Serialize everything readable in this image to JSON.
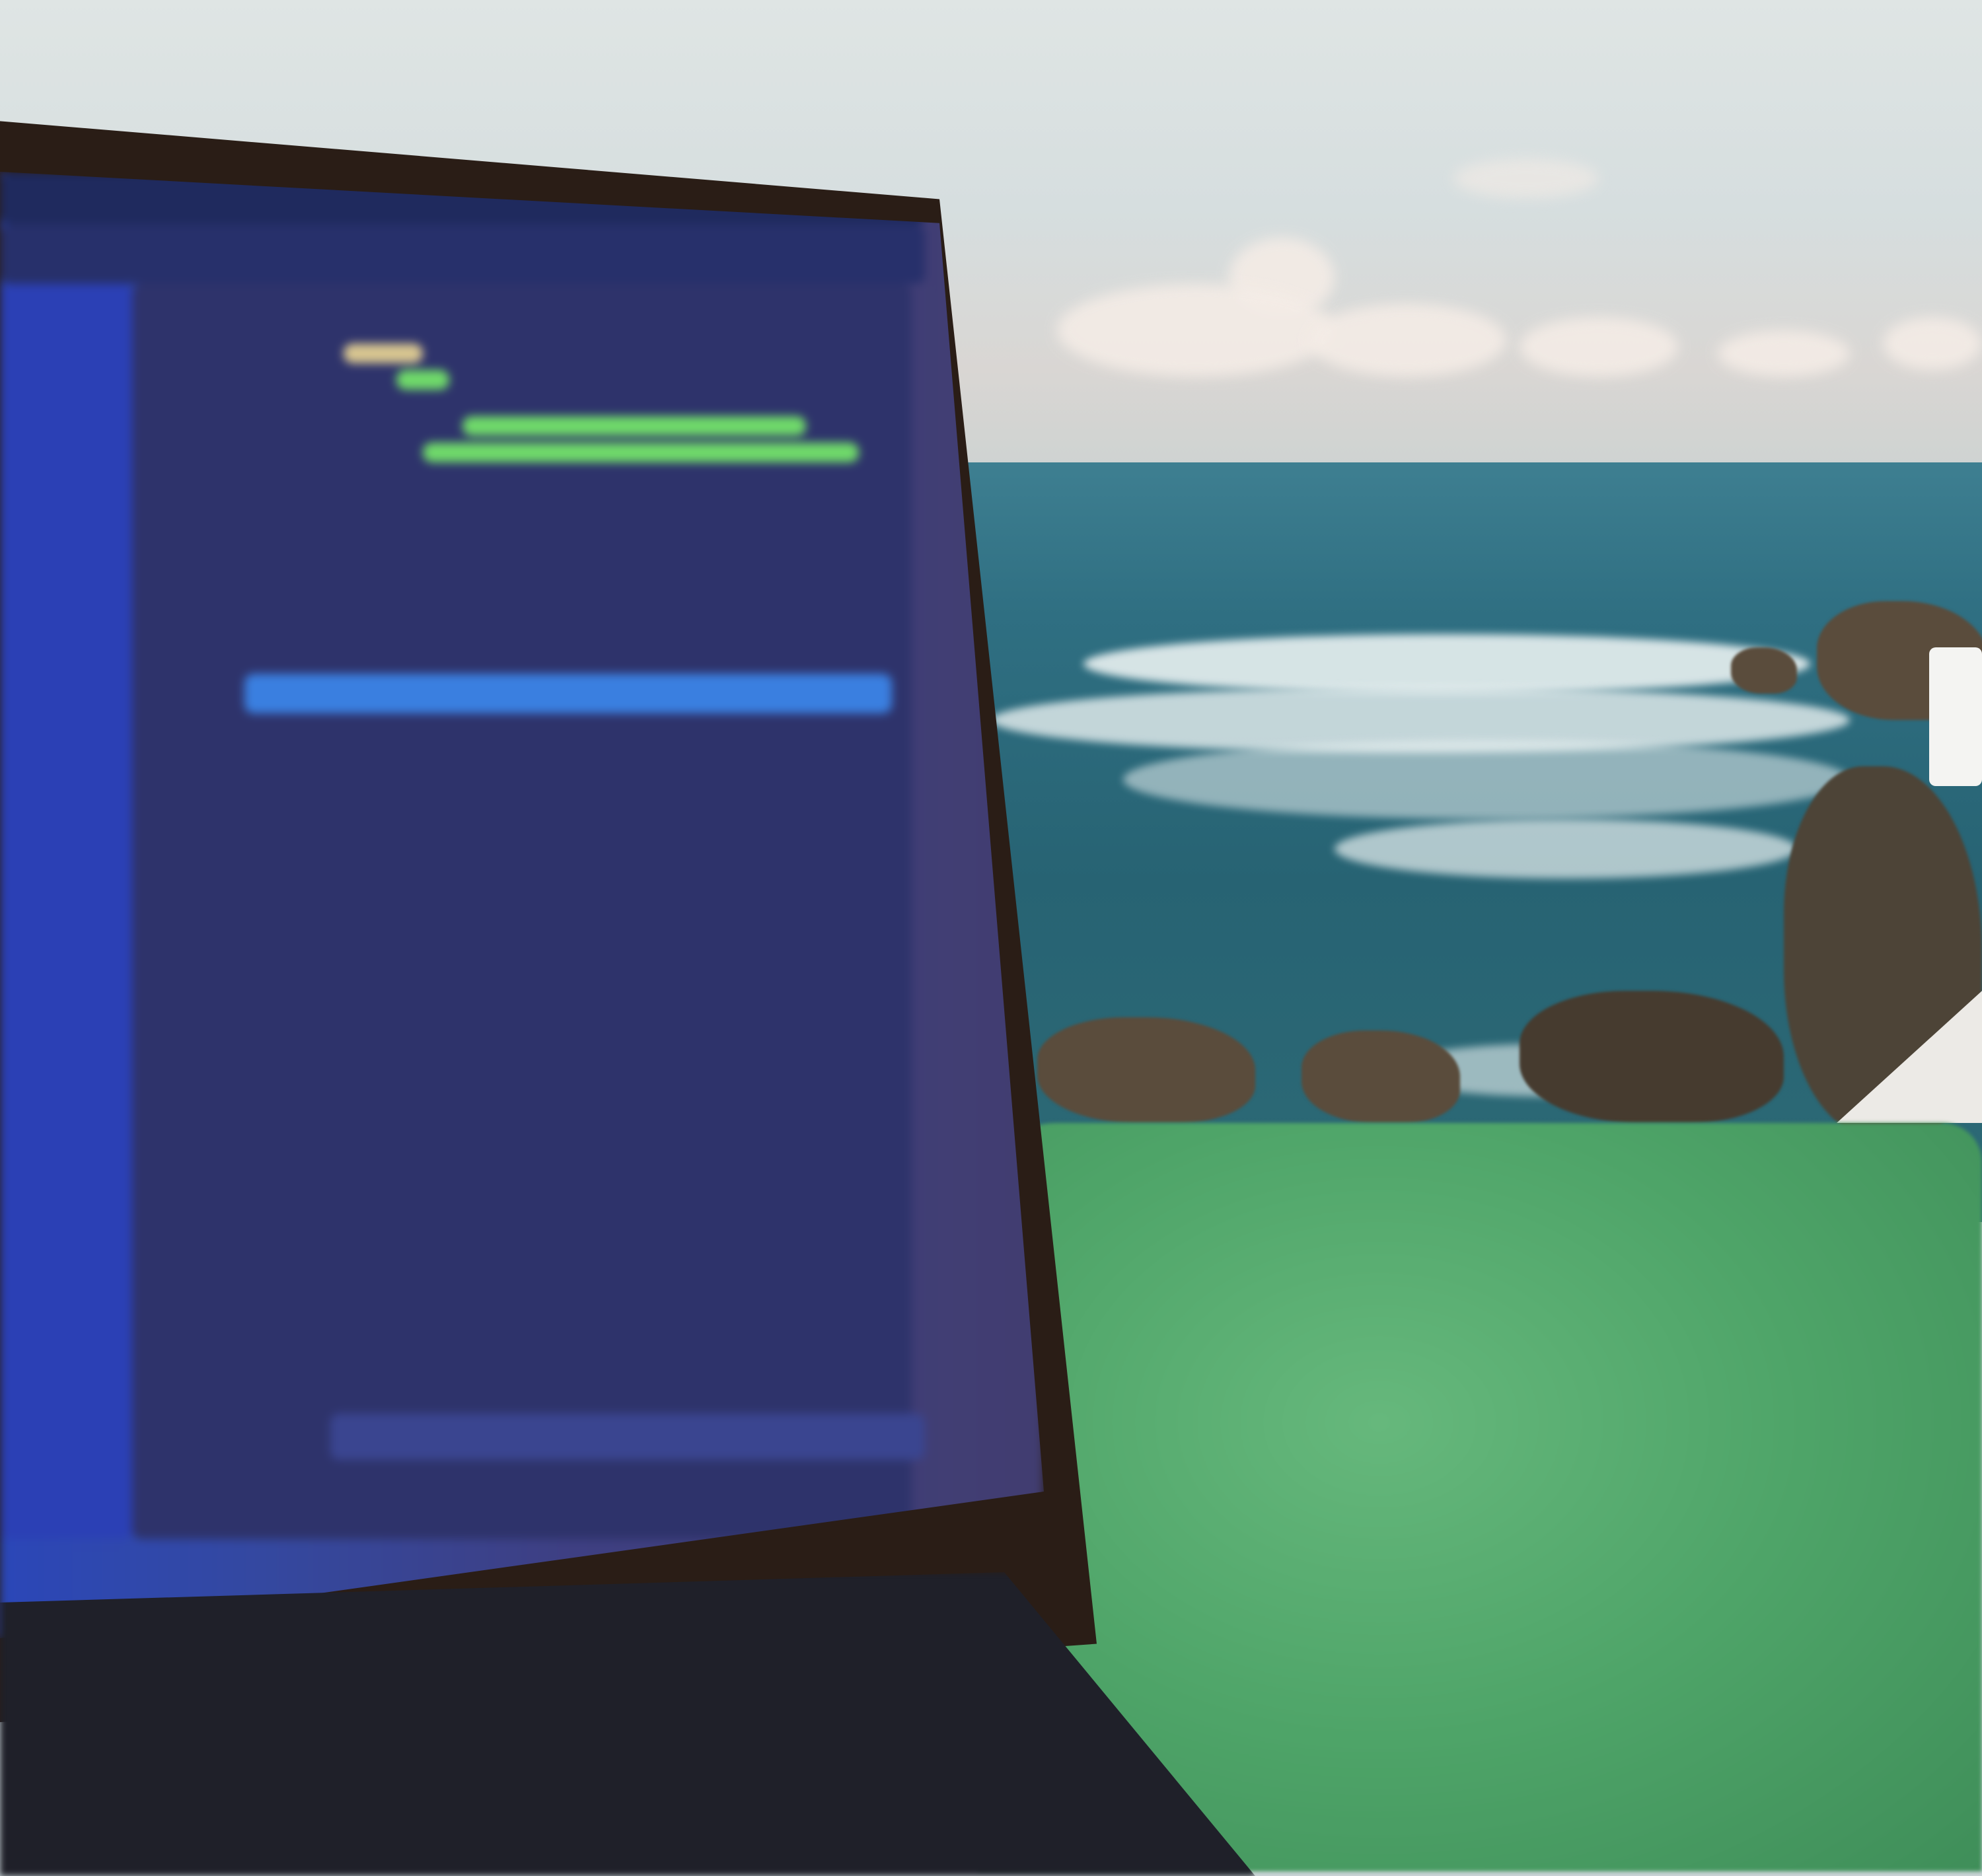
{
  "scene": {
    "subjects": [
      "laptop-code-editor",
      "ocean-waves",
      "rocky-shore",
      "green-towel"
    ],
    "colors": {
      "sky": "#dfe5e4",
      "sea": "#2f6f82",
      "towel": "#4ea468",
      "screen": "#3448a0",
      "rock": "#5a4c3c"
    }
  }
}
